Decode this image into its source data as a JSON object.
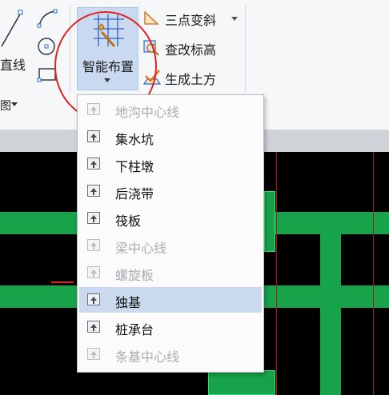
{
  "ribbon": {
    "left_label": "直线",
    "bottom_left_label": "图",
    "smart_button_label": "智能布置",
    "right_tools": [
      {
        "label": "三点变斜",
        "icon": "triangle-slope-icon",
        "has_dropdown": true
      },
      {
        "label": "查改标高",
        "icon": "elevation-search-icon",
        "has_dropdown": false
      },
      {
        "label": "生成土方",
        "icon": "earthwork-check-icon",
        "has_dropdown": false
      }
    ]
  },
  "menu": {
    "items": [
      {
        "label": "地沟中心线",
        "enabled": false,
        "highlighted": false
      },
      {
        "label": "集水坑",
        "enabled": true,
        "highlighted": false
      },
      {
        "label": "下柱墩",
        "enabled": true,
        "highlighted": false
      },
      {
        "label": "后浇带",
        "enabled": true,
        "highlighted": false
      },
      {
        "label": "筏板",
        "enabled": true,
        "highlighted": false
      },
      {
        "label": "梁中心线",
        "enabled": false,
        "highlighted": false
      },
      {
        "label": "螺旋板",
        "enabled": false,
        "highlighted": false
      },
      {
        "label": "独基",
        "enabled": true,
        "highlighted": true
      },
      {
        "label": "桩承台",
        "enabled": true,
        "highlighted": false
      },
      {
        "label": "条基中心线",
        "enabled": false,
        "highlighted": false
      }
    ]
  },
  "colors": {
    "canvas_bg": "#000000",
    "beam_green": "#16a34a",
    "axis_red": "#b01818",
    "highlight": "#cad9ee",
    "annotation_circle": "#e02020"
  }
}
